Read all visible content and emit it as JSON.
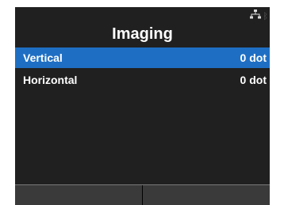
{
  "header": {
    "title": "Imaging",
    "status_icons": [
      "network-icon",
      "bluetooth-icon"
    ]
  },
  "menu": {
    "items": [
      {
        "label": "Vertical",
        "value": "0 dot",
        "selected": true
      },
      {
        "label": "Horizontal",
        "value": "0 dot",
        "selected": false
      }
    ]
  },
  "softkeys": {
    "left_label": "",
    "right_label": ""
  },
  "colors": {
    "background": "#202020",
    "selection": "#1e6fc4",
    "text": "#ffffff",
    "softkey_bar": "#3a3a3a"
  }
}
